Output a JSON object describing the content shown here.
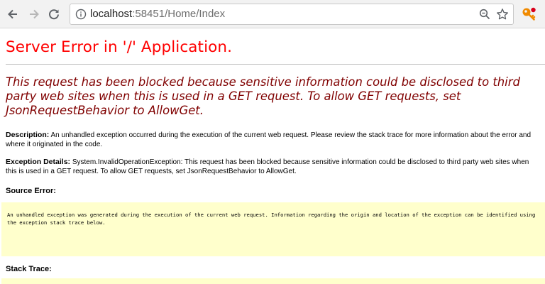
{
  "browser": {
    "url_host": "localhost",
    "url_rest": ":58451/Home/Index",
    "icons": {
      "back": "back-arrow-icon",
      "forward": "forward-arrow-icon",
      "reload": "reload-icon",
      "info": "info-icon",
      "zoom": "zoom-icon",
      "bookmark": "star-icon",
      "extension": "key-extension-icon"
    }
  },
  "page": {
    "title": "Server Error in '/' Application.",
    "message": "This request has been blocked because sensitive information could be disclosed to third party web sites when this is used in a GET request. To allow GET requests, set JsonRequestBehavior to AllowGet.",
    "description_label": "Description:",
    "description_text": "An unhandled exception occurred during the execution of the current web request. Please review the stack trace for more information about the error and where it originated in the code.",
    "exception_label": "Exception Details:",
    "exception_text": "System.InvalidOperationException: This request has been blocked because sensitive information could be disclosed to third party web sites when this is used in a GET request. To allow GET requests, set JsonRequestBehavior to AllowGet.",
    "source_error_label": "Source Error:",
    "source_error_text": "An unhandled exception was generated during the execution of the current web request. Information regarding the origin and location of the exception can be identified using the exception stack trace below.",
    "stack_trace_label": "Stack Trace:"
  },
  "colors": {
    "title": "#ff0000",
    "message": "#800000",
    "code_background": "#ffffcc",
    "extension_icon": "#f08a00"
  }
}
